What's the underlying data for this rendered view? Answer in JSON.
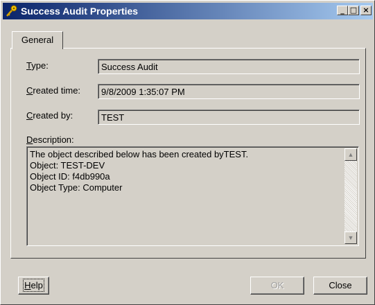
{
  "window": {
    "title": "Success Audit Properties",
    "icon": "key-icon",
    "controls": {
      "minimize": "_",
      "maximize": "□",
      "close": "×"
    }
  },
  "tabs": [
    {
      "label": "General",
      "selected": true
    }
  ],
  "fields": {
    "type": {
      "label_prefix": "T",
      "label_rest": "ype:",
      "value": "Success Audit"
    },
    "created_time": {
      "label_prefix": "C",
      "label_rest": "reated time:",
      "value": "9/8/2009 1:35:07 PM"
    },
    "created_by": {
      "label_prefix": "C",
      "label_rest": "reated by:",
      "value": "TEST"
    },
    "description": {
      "label_prefix": "D",
      "label_rest": "escription:",
      "lines": [
        "The object described below has been created byTEST.",
        "",
        "Object: TEST-DEV",
        "Object ID: f4db990a",
        "Object Type: Computer"
      ]
    }
  },
  "buttons": {
    "help": {
      "prefix": "H",
      "rest": "elp"
    },
    "ok": {
      "label": "OK"
    },
    "close": {
      "label": "Close"
    }
  }
}
